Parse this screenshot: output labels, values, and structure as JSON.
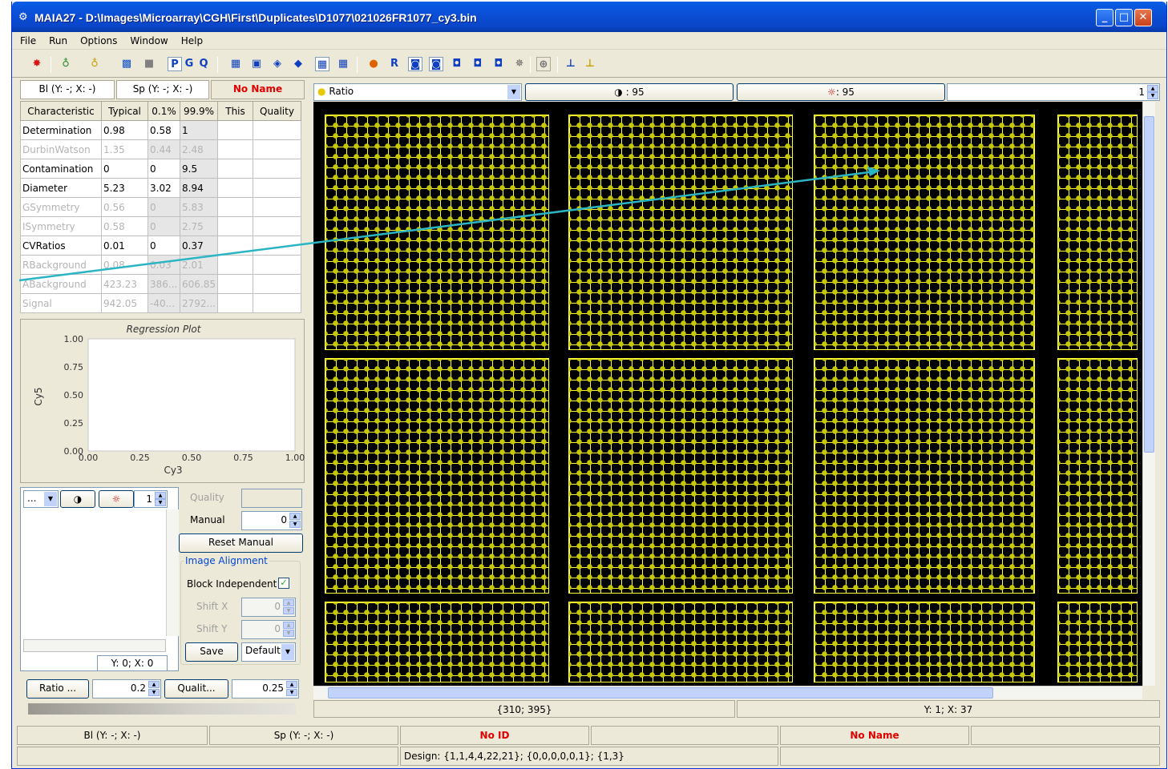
{
  "window": {
    "title": "MAIA27 - D:\\Images\\Microarray\\CGH\\First\\Duplicates\\D1077\\021026FR1077_cy3.bin",
    "minimize": "_",
    "maximize": "□",
    "close": "✕"
  },
  "menu": [
    "File",
    "Run",
    "Options",
    "Window",
    "Help"
  ],
  "toolbar": {
    "letters": [
      "P",
      "G",
      "Q"
    ]
  },
  "left_header": {
    "bl": "Bl (Y: -; X: -)",
    "sp": "Sp (Y: -; X: -)",
    "name": "No Name"
  },
  "characteristics": {
    "columns": [
      "Characteristic",
      "Typical",
      "0.1%",
      "99.9%",
      "This",
      "Quality"
    ],
    "rows": [
      {
        "name": "Determination",
        "typical": "0.98",
        "p01": "0.58",
        "p999": "1",
        "enabled": true
      },
      {
        "name": "DurbinWatson",
        "typical": "1.35",
        "p01": "0.44",
        "p999": "2.48",
        "enabled": false
      },
      {
        "name": "Contamination",
        "typical": "0",
        "p01": "0",
        "p999": "9.5",
        "enabled": true
      },
      {
        "name": "Diameter",
        "typical": "5.23",
        "p01": "3.02",
        "p999": "8.94",
        "enabled": true
      },
      {
        "name": "GSymmetry",
        "typical": "0.56",
        "p01": "0",
        "p999": "5.83",
        "enabled": false
      },
      {
        "name": "ISymmetry",
        "typical": "0.58",
        "p01": "0",
        "p999": "2.75",
        "enabled": false
      },
      {
        "name": "CVRatios",
        "typical": "0.01",
        "p01": "0",
        "p999": "0.37",
        "enabled": true
      },
      {
        "name": "RBackground",
        "typical": "0.08",
        "p01": "0.03",
        "p999": "2.01",
        "enabled": false
      },
      {
        "name": "ABackground",
        "typical": "423.23",
        "p01": "386...",
        "p999": "606.85",
        "enabled": false
      },
      {
        "name": "Signal",
        "typical": "942.05",
        "p01": "-40...",
        "p999": "2792...",
        "enabled": false
      }
    ]
  },
  "chart_data": {
    "type": "scatter",
    "title": "Regression Plot",
    "xlabel": "Cy3",
    "ylabel": "Cy5",
    "xlim": [
      0,
      1
    ],
    "ylim": [
      0,
      1
    ],
    "xticks": [
      "0.00",
      "0.25",
      "0.50",
      "0.75",
      "1.00"
    ],
    "yticks": [
      "0.00",
      "0.25",
      "0.50",
      "0.75",
      "1.00"
    ],
    "points": []
  },
  "controls": {
    "dropdown_value": "...",
    "spinner_value": "1",
    "quality_label": "Quality",
    "manual_label": "Manual",
    "manual_value": "0",
    "reset_manual": "Reset Manual",
    "image_alignment": "Image Alignment",
    "block_independent": "Block Independent",
    "shift_x_label": "Shift X",
    "shift_x_value": "0",
    "shift_y_label": "Shift Y",
    "shift_y_value": "0",
    "save": "Save",
    "default": "Default",
    "coords": "Y: 0; X: 0",
    "ratio_btn": "Ratio ...",
    "ratio_value": "0.2",
    "quality_btn": "Qualit...",
    "quality_value": "0.25"
  },
  "image_header": {
    "mode": "Ratio",
    "contrast": "◑ : 95",
    "brightness": ": 95",
    "page": "1"
  },
  "image_status": {
    "position": "{310; 395}",
    "grid": "Y: 1; X: 37"
  },
  "statusbar": {
    "bl": "Bl (Y: -; X: -)",
    "sp": "Sp (Y: -; X: -)",
    "id": "No ID",
    "name": "No Name",
    "design": "Design: {1,1,4,4,22,21}; {0,0,0,0,0,1}; {1,3}"
  },
  "colors": {
    "spot_grid": "#ffff33",
    "annotation_arrow": "#2bb5c4",
    "red_text": "#e00000"
  }
}
